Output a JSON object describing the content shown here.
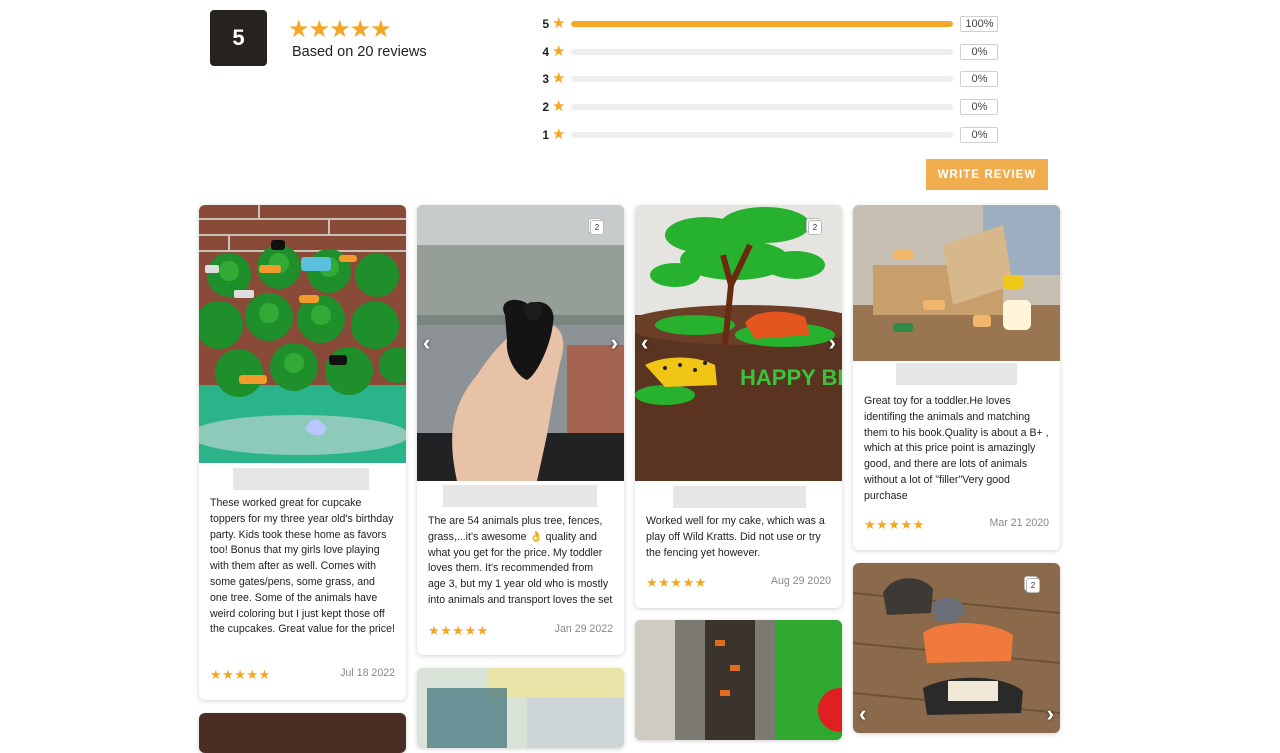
{
  "summary": {
    "average": "5",
    "stars": "★★★★★",
    "based_on": "Based on 20 reviews"
  },
  "histogram": [
    {
      "rating": "5",
      "percent_label": "100%",
      "fill": 1.0
    },
    {
      "rating": "4",
      "percent_label": "0%",
      "fill": 0
    },
    {
      "rating": "3",
      "percent_label": "0%",
      "fill": 0
    },
    {
      "rating": "2",
      "percent_label": "0%",
      "fill": 0
    },
    {
      "rating": "1",
      "percent_label": "0%",
      "fill": 0
    }
  ],
  "star_glyph": "★",
  "write_review_label": "WRITE REVIEW",
  "colors": {
    "accent": "#f5a623",
    "button": "#f0ad4e",
    "dark_box": "#26231f"
  },
  "reviews": [
    {
      "text": "These worked great for cupcake toppers for my three year old's birthday party. Kids took these home as favors too! Bonus that my girls love playing with them after as well. Comes with some gates/pens, some grass, and one tree. Some of the animals have weird coloring but I just kept those off the cupcakes. Great value for the price!",
      "stars": "★★★★★",
      "rating": 5,
      "date": "Jul 18 2022"
    },
    {
      "text": "The are 54 animals plus tree, fences, grass,...it's awesome 👌 quality and what you get for the price. My toddler loves them. It's recommended from age 3, but my 1 year old who is mostly into animals and transport loves the set",
      "stars": "★★★★★",
      "rating": 5,
      "date": "Jan 29 2022",
      "photo_count": "2"
    },
    {
      "text": "Worked well for my cake, which was a play off Wild Kratts. Did not use or try the fencing yet however.",
      "stars": "★★★★★",
      "rating": 5,
      "date": "Aug 29 2020",
      "photo_count": "2",
      "photo_text": "HAPPY BIRTHDAY Rex"
    },
    {
      "text": "Great toy for a toddler.He loves identifing the animals and matching them to his book.Quality is about a B+ , which at this price point is amazingly good, and there are lots of animals without a lot of \"filler\"Very good purchase",
      "stars": "★★★★★",
      "rating": 5,
      "date": "Mar 21 2020"
    },
    {
      "photo_count": "2"
    }
  ],
  "icons": {
    "prev": "‹",
    "next": "›"
  }
}
